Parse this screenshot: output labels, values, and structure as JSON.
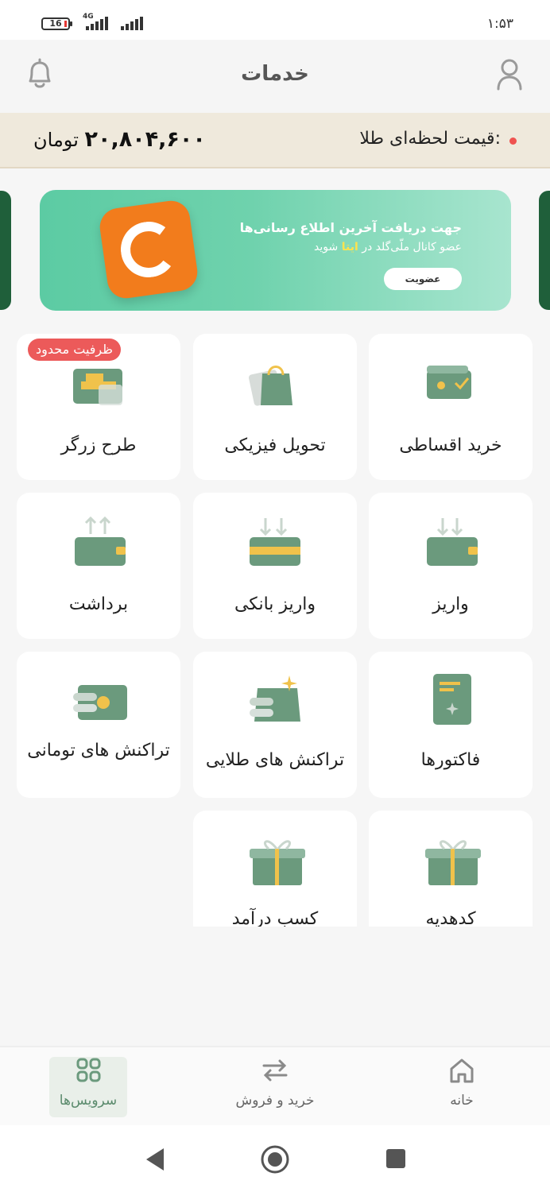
{
  "status": {
    "battery": "16",
    "network": "4G",
    "time": "۱:۵۳"
  },
  "header": {
    "title": "خدمات"
  },
  "gold": {
    "label": "قیمت لحظه‌ای طلا:",
    "price": "۲۰,۸۰۴,۶۰۰",
    "unit": "تومان"
  },
  "banner": {
    "line1": "جهت دریافت آخرین اطلاع رسانی‌ها",
    "line2_pre": "عضو کانال ملّی‌گلد در ",
    "line2_highlight": "ایتا",
    "line2_post": " شوید",
    "button": "عضویت"
  },
  "services": {
    "badge": "ظرفیت محدود",
    "items": [
      {
        "label": "خرید اقساطی",
        "icon": "installment-wallet-icon"
      },
      {
        "label": "تحویل فیزیکی",
        "icon": "shopping-bag-icon"
      },
      {
        "label": "طرح زرگر",
        "icon": "gold-bars-icon"
      },
      {
        "label": "واریز",
        "icon": "deposit-wallet-icon"
      },
      {
        "label": "واریز بانکی",
        "icon": "bank-deposit-icon"
      },
      {
        "label": "برداشت",
        "icon": "withdraw-wallet-icon"
      },
      {
        "label": "فاکتورها",
        "icon": "invoice-icon"
      },
      {
        "label": "تراکنش های طلایی",
        "icon": "gold-transactions-icon"
      },
      {
        "label": "تراکنش های تومانی",
        "icon": "toman-transactions-icon"
      },
      {
        "label": "کدهدیه",
        "icon": "gift-icon"
      },
      {
        "label": "کسب درآمد",
        "icon": "gift-icon"
      }
    ]
  },
  "nav": {
    "home": "خانه",
    "trade": "خرید و فروش",
    "services": "سرویس‌ها"
  },
  "colors": {
    "green": "#6b9a7d",
    "gold": "#f0c24b",
    "accent": "#5ccba3",
    "badge": "#ec5a5a"
  }
}
